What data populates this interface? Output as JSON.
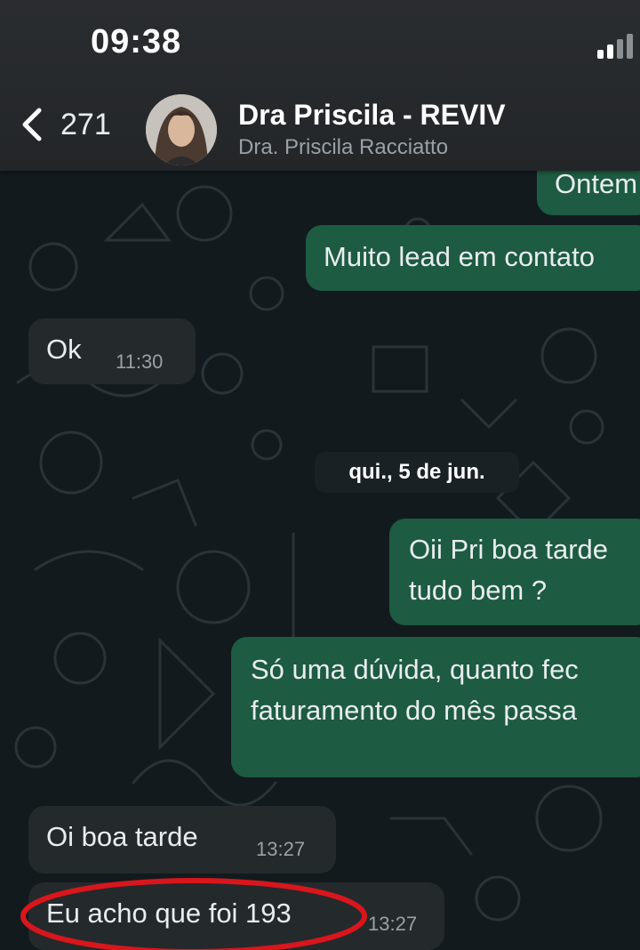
{
  "status_bar": {
    "time": "09:38"
  },
  "header": {
    "back_count": "271",
    "contact_name": "Dra Priscila - REVIV",
    "contact_subtitle": "Dra. Priscila Racciatto"
  },
  "icons": [
    "chevron-left-icon",
    "signal-icon",
    "avatar-photo"
  ],
  "colors": {
    "outgoing_bubble": "#1d5b42",
    "incoming_bubble": "#24292c",
    "highlight_ring": "#d8161c",
    "background": "#121a1e"
  },
  "messages": [
    {
      "direction": "out",
      "text": "Ontem",
      "time": ""
    },
    {
      "direction": "out",
      "text": "Muito lead em contato",
      "time": ""
    },
    {
      "direction": "in",
      "text": "Ok",
      "time": "11:30"
    },
    {
      "direction": "date",
      "text": "qui., 5 de jun."
    },
    {
      "direction": "out",
      "lines": [
        "Oii Pri boa tarde",
        "tudo bem ?"
      ],
      "time": ""
    },
    {
      "direction": "out",
      "lines": [
        "Só uma dúvida, quanto fec",
        "faturamento do mês passa"
      ],
      "time": ""
    },
    {
      "direction": "in",
      "text": "Oi boa tarde",
      "time": "13:27"
    },
    {
      "direction": "in",
      "text": "Eu acho que foi 193",
      "time": "13:27",
      "highlighted": true
    }
  ]
}
